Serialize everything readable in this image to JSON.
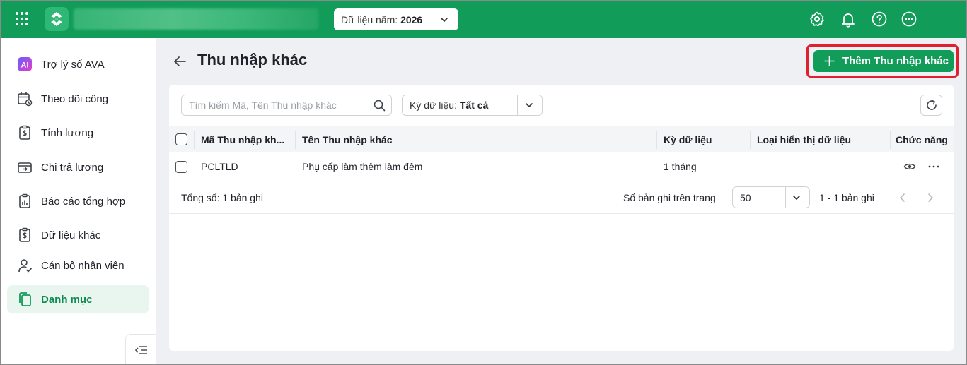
{
  "topbar": {
    "year_label": "Dữ liệu năm:",
    "year_value": "2026",
    "icons": [
      "apps-grid-icon",
      "app-logo",
      "settings-gear-icon",
      "bell-icon",
      "help-icon",
      "more-icon"
    ]
  },
  "sidebar": {
    "items": [
      {
        "label": "Trợ lý số AVA",
        "icon": "ai-icon"
      },
      {
        "label": "Theo dõi công",
        "icon": "calendar-clock-icon"
      },
      {
        "label": "Tính lương",
        "icon": "clipboard-dollar-icon"
      },
      {
        "label": "Chi trả lương",
        "icon": "wallet-transfer-icon"
      },
      {
        "label": "Báo cáo tổng hợp",
        "icon": "report-chart-icon"
      },
      {
        "label": "Dữ liệu khác",
        "icon": "clipboard-dollar-icon"
      },
      {
        "label": "Cán bộ nhân viên",
        "icon": "user-check-icon"
      },
      {
        "label": "Danh mục",
        "icon": "copy-docs-icon",
        "active": true
      }
    ]
  },
  "page": {
    "title": "Thu nhập khác",
    "add_button": "Thêm Thu nhập khác"
  },
  "filters": {
    "search_placeholder": "Tìm kiếm Mã, Tên Thu nhập khác",
    "period_label": "Kỳ dữ liệu:",
    "period_value": "Tất cả"
  },
  "table": {
    "columns": [
      "Mã Thu nhập kh...",
      "Tên Thu nhập khác",
      "Kỳ dữ liệu",
      "Loại hiển thị dữ liệu",
      "Chức năng"
    ],
    "rows": [
      {
        "code": "PCLTLD",
        "name": "Phụ cấp làm thêm làm đêm",
        "period": "1 tháng",
        "display_type": ""
      }
    ]
  },
  "footer": {
    "total": "Tổng số: 1 bản ghi",
    "page_size_label": "Số bản ghi trên trang",
    "page_size": "50",
    "range": "1 - 1 bản ghi"
  },
  "colors": {
    "brand": "#129c5a",
    "highlight": "#e0202e"
  }
}
